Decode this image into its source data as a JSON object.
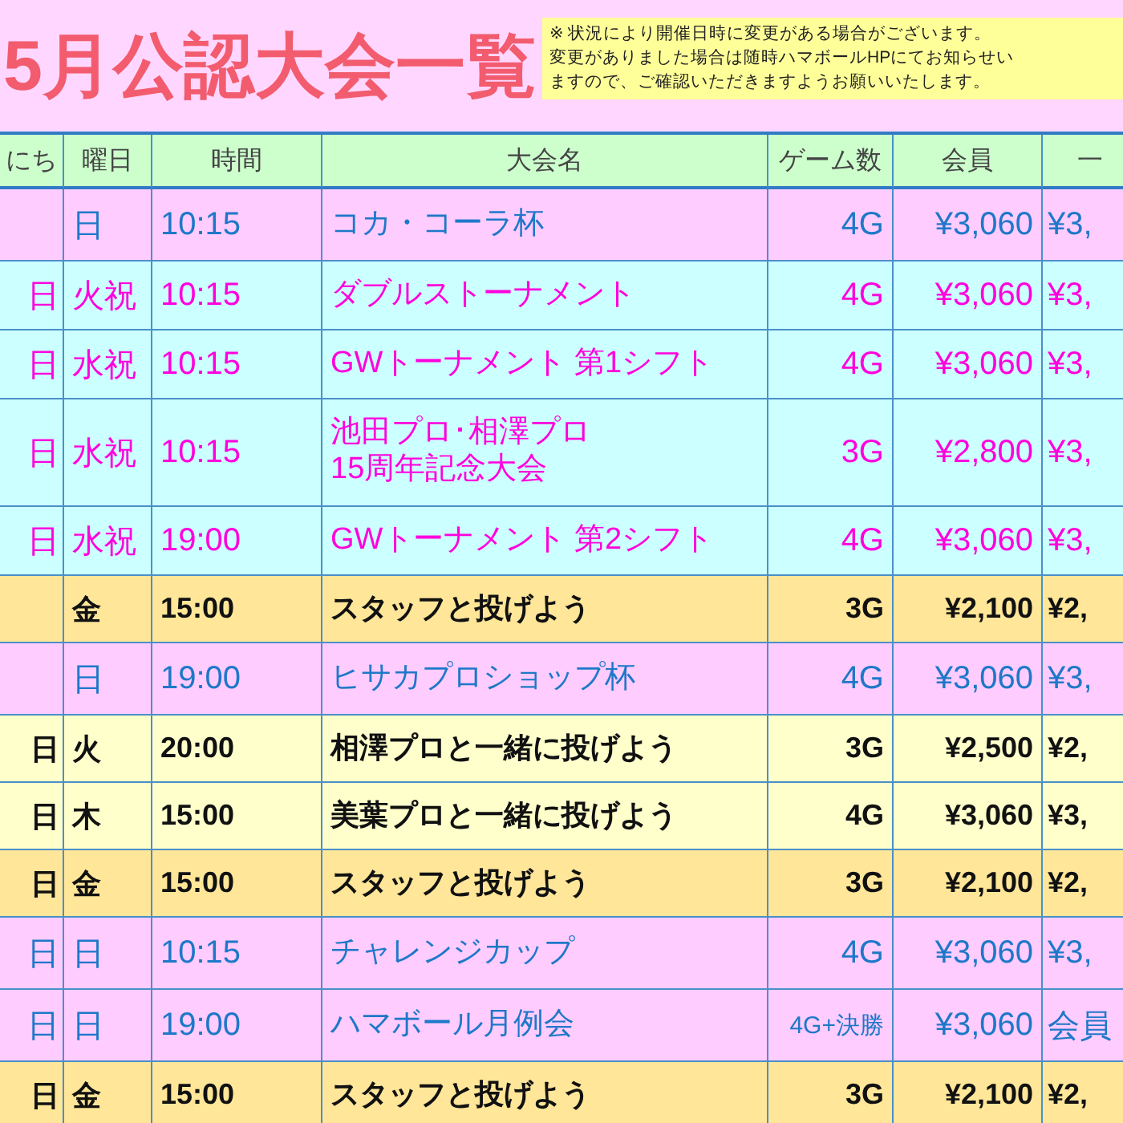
{
  "title": "5月公認大会一覧",
  "notice": [
    "※ 状況により開催日時に変更がある場合がございます。",
    "変更がありました場合は随時ハマボールHPにてお知らせい",
    "ますので、ご確認いただきますようお願いいたします。"
  ],
  "table": {
    "columns": [
      "にち",
      "曜日",
      "時間",
      "大会名",
      "ゲーム数",
      "会員",
      "一"
    ],
    "rows": [
      {
        "kind": "special",
        "cells": [
          "",
          "日",
          "10:15",
          "コカ・コーラ杯",
          "4G",
          "¥3,060",
          "¥3,"
        ]
      },
      {
        "kind": "holiday",
        "cells": [
          "日",
          "火祝",
          "10:15",
          "ダブルストーナメント",
          "4G",
          "¥3,060",
          "¥3,"
        ]
      },
      {
        "kind": "holiday",
        "cells": [
          "日",
          "水祝",
          "10:15",
          "GWトーナメント 第1シフト",
          "4G",
          "¥3,060",
          "¥3,"
        ]
      },
      {
        "kind": "holiday",
        "cells": [
          "日",
          "水祝",
          "10:15",
          "池田プロ･相澤プロ\n15周年記念大会",
          "3G",
          "¥2,800",
          "¥3,"
        ]
      },
      {
        "kind": "holiday",
        "cells": [
          "日",
          "水祝",
          "19:00",
          "GWトーナメント 第2シフト",
          "4G",
          "¥3,060",
          "¥3,"
        ]
      },
      {
        "kind": "staff",
        "cells": [
          "",
          "金",
          "15:00",
          "スタッフと投げよう",
          "3G",
          "¥2,100",
          "¥2,"
        ]
      },
      {
        "kind": "special",
        "cells": [
          "",
          "日",
          "19:00",
          "ヒサカプロショップ杯",
          "4G",
          "¥3,060",
          "¥3,"
        ]
      },
      {
        "kind": "pro",
        "cells": [
          "日",
          "火",
          "20:00",
          "相澤プロと一緒に投げよう",
          "3G",
          "¥2,500",
          "¥2,"
        ]
      },
      {
        "kind": "pro",
        "cells": [
          "日",
          "木",
          "15:00",
          "美葉プロと一緒に投げよう",
          "4G",
          "¥3,060",
          "¥3,"
        ]
      },
      {
        "kind": "staff",
        "cells": [
          "日",
          "金",
          "15:00",
          "スタッフと投げよう",
          "3G",
          "¥2,100",
          "¥2,"
        ]
      },
      {
        "kind": "special",
        "cells": [
          "日",
          "日",
          "10:15",
          "チャレンジカップ",
          "4G",
          "¥3,060",
          "¥3,"
        ]
      },
      {
        "kind": "special",
        "cells": [
          "日",
          "日",
          "19:00",
          "ハマボール月例会",
          "4G+決勝",
          "¥3,060",
          "会員"
        ]
      },
      {
        "kind": "staff",
        "cells": [
          "日",
          "金",
          "15:00",
          "スタッフと投げよう",
          "3G",
          "¥2,100",
          "¥2,"
        ]
      }
    ]
  }
}
